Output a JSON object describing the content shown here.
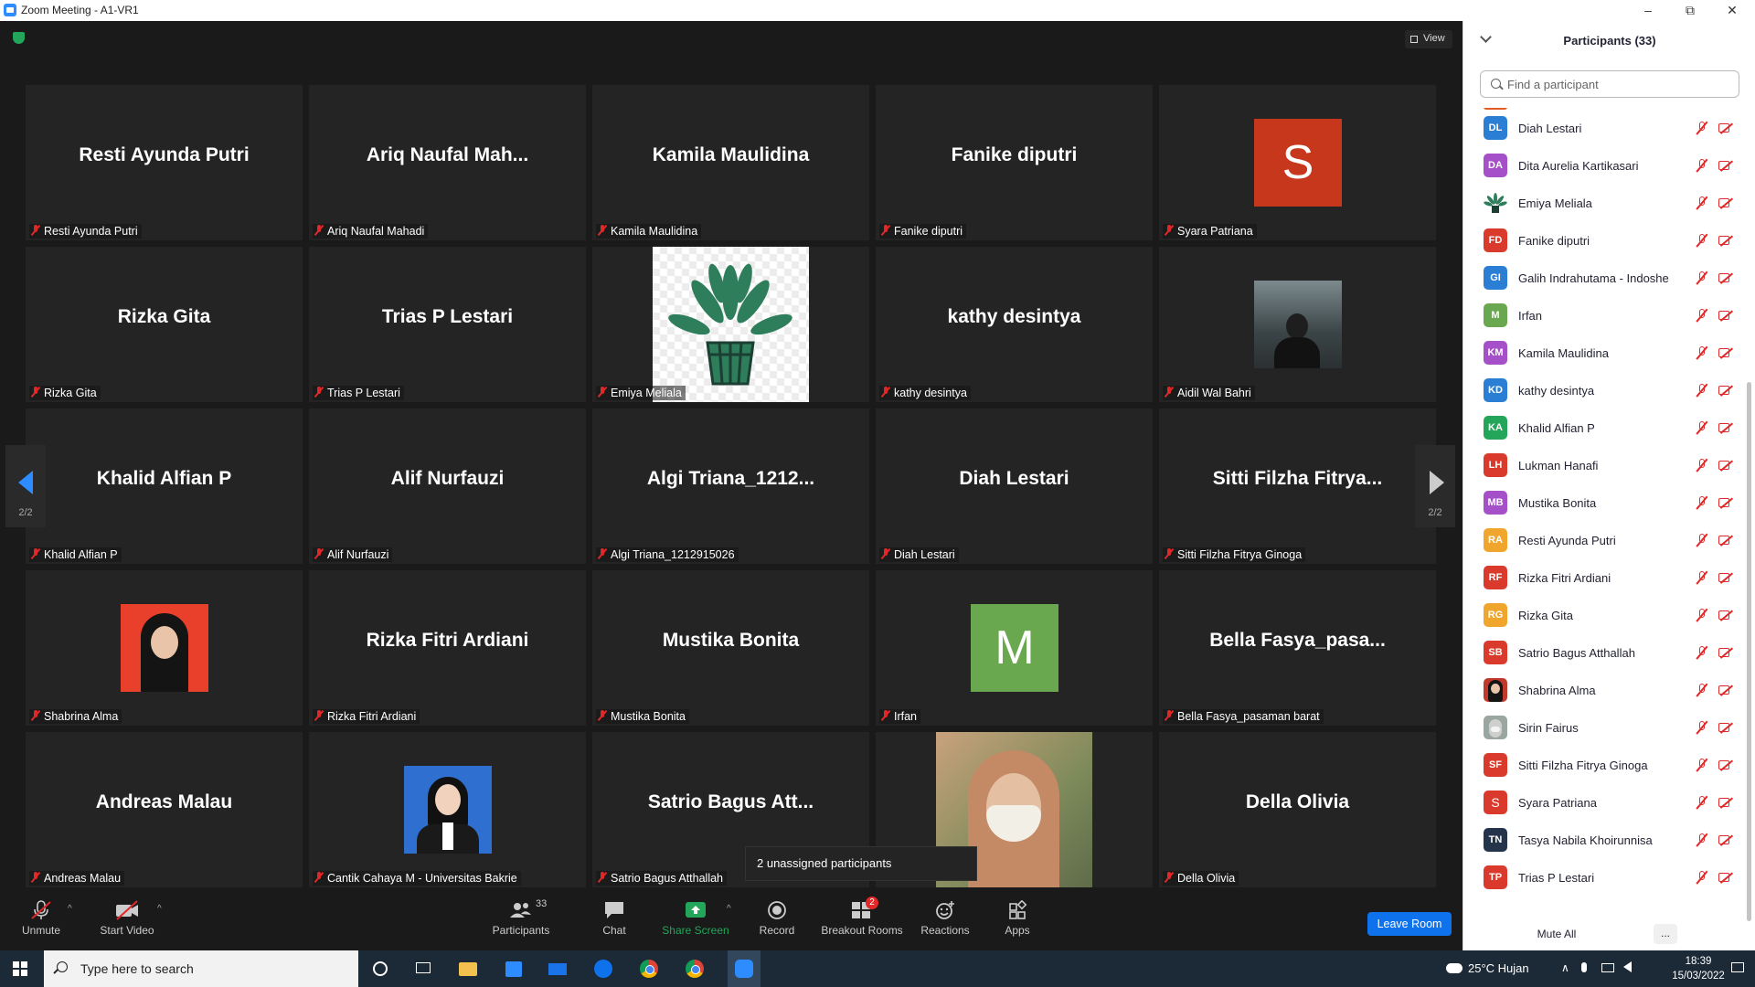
{
  "window": {
    "title": "Zoom Meeting - A1-VR1",
    "minimize": "–",
    "restore": "⧉",
    "close": "✕"
  },
  "view_button": "View",
  "pagination": {
    "left": "2/2",
    "right": "2/2"
  },
  "tiles": [
    {
      "name": "Resti Ayunda Putri",
      "label": "Resti Ayunda Putri"
    },
    {
      "name": "Ariq Naufal Mah...",
      "label": "Ariq Naufal Mahadi"
    },
    {
      "name": "Kamila Maulidina",
      "label": "Kamila Maulidina"
    },
    {
      "name": "Fanike diputri",
      "label": "Fanike diputri"
    },
    {
      "name": "",
      "label": "Syara Patriana",
      "avatar": "S"
    },
    {
      "name": "Rizka Gita",
      "label": "Rizka Gita"
    },
    {
      "name": "Trias P Lestari",
      "label": "Trias P Lestari"
    },
    {
      "name": "",
      "label": "Emiya Meliala"
    },
    {
      "name": "kathy desintya",
      "label": "kathy desintya"
    },
    {
      "name": "",
      "label": "Aidil Wal Bahri"
    },
    {
      "name": "Khalid Alfian P",
      "label": "Khalid Alfian P"
    },
    {
      "name": "Alif Nurfauzi",
      "label": "Alif Nurfauzi"
    },
    {
      "name": "Algi Triana_1212...",
      "label": "Algi Triana_1212915026"
    },
    {
      "name": "Diah Lestari",
      "label": "Diah Lestari"
    },
    {
      "name": "Sitti Filzha Fitrya...",
      "label": "Sitti Filzha Fitrya Ginoga"
    },
    {
      "name": "",
      "label": "Shabrina Alma"
    },
    {
      "name": "Rizka Fitri Ardiani",
      "label": "Rizka Fitri Ardiani"
    },
    {
      "name": "Mustika Bonita",
      "label": "Mustika Bonita"
    },
    {
      "name": "",
      "label": "Irfan",
      "avatar": "M"
    },
    {
      "name": "Bella Fasya_pasa...",
      "label": "Bella Fasya_pasaman barat"
    },
    {
      "name": "Andreas Malau",
      "label": "Andreas Malau"
    },
    {
      "name": "",
      "label": "Cantik Cahaya M - Universitas Bakrie"
    },
    {
      "name": "Satrio Bagus Att...",
      "label": "Satrio Bagus Atthallah"
    },
    {
      "name": "",
      "label": ""
    },
    {
      "name": "Della Olivia",
      "label": "Della Olivia"
    }
  ],
  "popup": "2 unassigned participants",
  "toolbar": {
    "unmute": "Unmute",
    "start_video": "Start Video",
    "participants": "Participants",
    "participants_count": "33",
    "chat": "Chat",
    "share_screen": "Share Screen",
    "record": "Record",
    "breakout_rooms": "Breakout Rooms",
    "breakout_badge": "2",
    "reactions": "Reactions",
    "apps": "Apps",
    "leave_room": "Leave Room",
    "caret": "^"
  },
  "panel": {
    "title": "Participants (33)",
    "search_placeholder": "Find a participant",
    "mute_all": "Mute All",
    "more": "...",
    "participants": [
      {
        "initials": "DL",
        "name": "Diah Lestari",
        "color": "#2a7fd4"
      },
      {
        "initials": "DA",
        "name": "Dita Aurelia Kartikasari",
        "color": "#a54fc9"
      },
      {
        "initials": "",
        "name": "Emiya Meliala",
        "color": "#ffffff"
      },
      {
        "initials": "FD",
        "name": "Fanike diputri",
        "color": "#d93a2b"
      },
      {
        "initials": "GI",
        "name": "Galih Indrahutama - Indoshe",
        "color": "#2a7fd4"
      },
      {
        "initials": "M",
        "name": "Irfan",
        "color": "#6aa84f"
      },
      {
        "initials": "KM",
        "name": "Kamila Maulidina",
        "color": "#a54fc9"
      },
      {
        "initials": "KD",
        "name": "kathy desintya",
        "color": "#2a7fd4"
      },
      {
        "initials": "KA",
        "name": "Khalid Alfian P",
        "color": "#23a55a"
      },
      {
        "initials": "LH",
        "name": "Lukman Hanafi",
        "color": "#d93a2b"
      },
      {
        "initials": "MB",
        "name": "Mustika Bonita",
        "color": "#a54fc9"
      },
      {
        "initials": "RA",
        "name": "Resti Ayunda Putri",
        "color": "#f0a52c"
      },
      {
        "initials": "RF",
        "name": "Rizka Fitri Ardiani",
        "color": "#d93a2b"
      },
      {
        "initials": "RG",
        "name": "Rizka Gita",
        "color": "#f0a52c"
      },
      {
        "initials": "SB",
        "name": "Satrio Bagus Atthallah",
        "color": "#d93a2b"
      },
      {
        "initials": "",
        "name": "Shabrina Alma",
        "color": "#c0392b"
      },
      {
        "initials": "",
        "name": "Sirin Fairus",
        "color": "#9aa6a0"
      },
      {
        "initials": "SF",
        "name": "Sitti Filzha Fitrya Ginoga",
        "color": "#d93a2b"
      },
      {
        "initials": "S",
        "name": "Syara Patriana",
        "color": "#d93a2b"
      },
      {
        "initials": "TN",
        "name": "Tasya Nabila Khoirunnisa",
        "color": "#24344a"
      },
      {
        "initials": "TP",
        "name": "Trias P Lestari",
        "color": "#d93a2b"
      }
    ]
  },
  "taskbar": {
    "search_placeholder": "Type here to search",
    "weather": "25°C  Hujan",
    "time": "18:39",
    "date": "15/03/2022"
  },
  "colors": {
    "accent": "#0e72ed",
    "share_green": "#23a55a",
    "muted_red": "#e02828",
    "tile_bg": "#242424"
  }
}
